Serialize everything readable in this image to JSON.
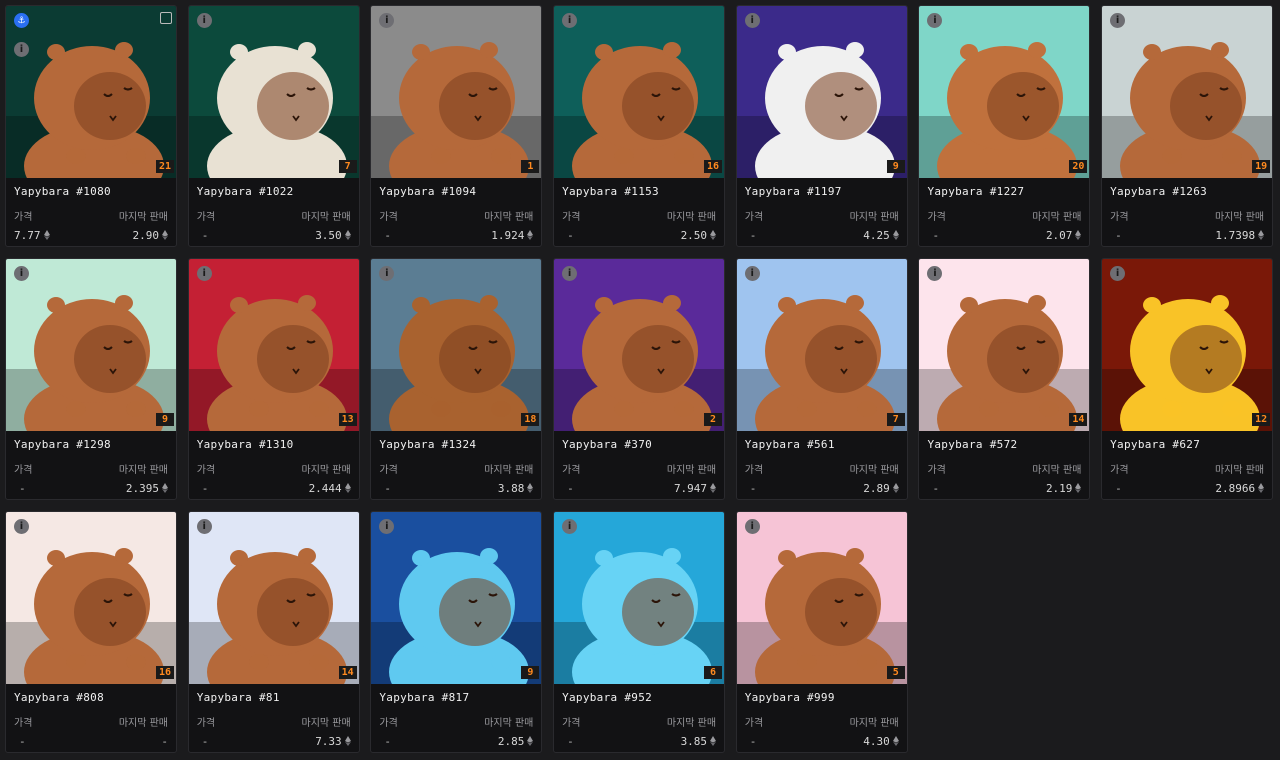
{
  "labels": {
    "price": "가격",
    "last_sale": "마지막 판매",
    "info_glyph": "i"
  },
  "cards": [
    {
      "name": "Yapybara #1080",
      "price": "7.77",
      "last": "2.90",
      "rank": "21",
      "bg": "#0b3b33",
      "fur": "#b5693a"
    },
    {
      "name": "Yapybara #1022",
      "price": "-",
      "last": "3.50",
      "rank": "7",
      "bg": "#0c4a3c",
      "fur": "#e8e1d3"
    },
    {
      "name": "Yapybara #1094",
      "price": "-",
      "last": "1.924",
      "rank": "1",
      "bg": "#8b8b8b",
      "fur": "#b5693a"
    },
    {
      "name": "Yapybara #1153",
      "price": "-",
      "last": "2.50",
      "rank": "16",
      "bg": "#0e5f5a",
      "fur": "#b5693a"
    },
    {
      "name": "Yapybara #1197",
      "price": "-",
      "last": "4.25",
      "rank": "9",
      "bg": "#3b2a8a",
      "fur": "#f0f0f0"
    },
    {
      "name": "Yapybara #1227",
      "price": "-",
      "last": "2.07",
      "rank": "20",
      "bg": "#7fd6c8",
      "fur": "#c0713d"
    },
    {
      "name": "Yapybara #1263",
      "price": "-",
      "last": "1.7398",
      "rank": "19",
      "bg": "#c9d3d3",
      "fur": "#b5693a"
    },
    {
      "name": "Yapybara #1298",
      "price": "-",
      "last": "2.395",
      "rank": "9",
      "bg": "#bfe9d6",
      "fur": "#b5693a"
    },
    {
      "name": "Yapybara #1310",
      "price": "-",
      "last": "2.444",
      "rank": "13",
      "bg": "#c42034",
      "fur": "#b5693a"
    },
    {
      "name": "Yapybara #1324",
      "price": "-",
      "last": "3.88",
      "rank": "18",
      "bg": "#5b7d93",
      "fur": "#a9622f"
    },
    {
      "name": "Yapybara #370",
      "price": "-",
      "last": "7.947",
      "rank": "2",
      "bg": "#5a2a9a",
      "fur": "#b5693a"
    },
    {
      "name": "Yapybara #561",
      "price": "-",
      "last": "2.89",
      "rank": "7",
      "bg": "#9fc4ef",
      "fur": "#b5693a"
    },
    {
      "name": "Yapybara #572",
      "price": "-",
      "last": "2.19",
      "rank": "14",
      "bg": "#fde4ec",
      "fur": "#b5693a"
    },
    {
      "name": "Yapybara #627",
      "price": "-",
      "last": "2.8966",
      "rank": "12",
      "bg": "#7a1808",
      "fur": "#f9c327"
    },
    {
      "name": "Yapybara #808",
      "price": "-",
      "last": "-",
      "rank": "16",
      "bg": "#f5e8e4",
      "fur": "#b5693a"
    },
    {
      "name": "Yapybara #81",
      "price": "-",
      "last": "7.33",
      "rank": "14",
      "bg": "#dfe6f6",
      "fur": "#b5693a"
    },
    {
      "name": "Yapybara #817",
      "price": "-",
      "last": "2.85",
      "rank": "9",
      "bg": "#1a4f9f",
      "fur": "#5fc9f0"
    },
    {
      "name": "Yapybara #952",
      "price": "-",
      "last": "3.85",
      "rank": "6",
      "bg": "#25a7d9",
      "fur": "#67d3f5"
    },
    {
      "name": "Yapybara #999",
      "price": "-",
      "last": "4.30",
      "rank": "5",
      "bg": "#f6c4d6",
      "fur": "#b5693a"
    }
  ]
}
